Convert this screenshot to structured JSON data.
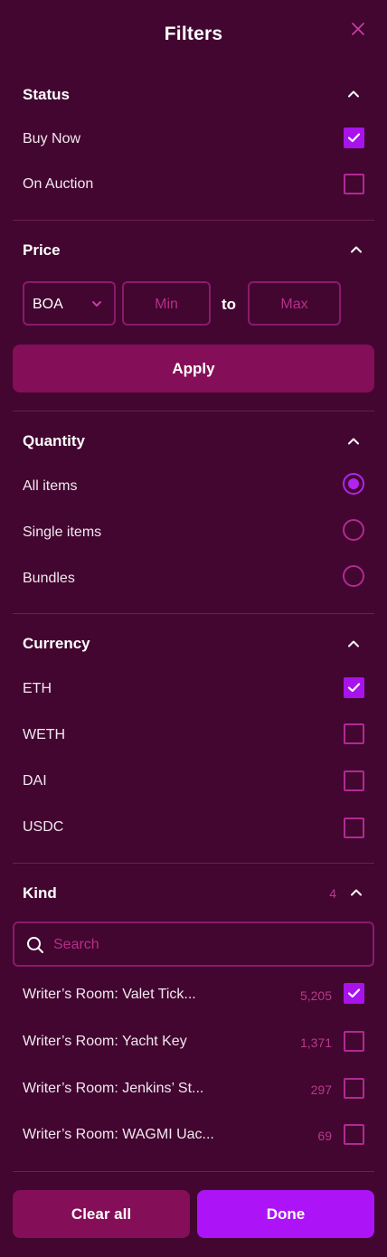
{
  "header": {
    "title": "Filters",
    "close_icon": "close-icon"
  },
  "status": {
    "title": "Status",
    "items": [
      {
        "label": "Buy Now",
        "checked": true
      },
      {
        "label": "On Auction",
        "checked": false
      }
    ]
  },
  "price": {
    "title": "Price",
    "currency_selected": "BOA",
    "min_placeholder": "Min",
    "to_label": "to",
    "max_placeholder": "Max",
    "apply_label": "Apply"
  },
  "quantity": {
    "title": "Quantity",
    "options": [
      {
        "label": "All items",
        "selected": true
      },
      {
        "label": "Single items",
        "selected": false
      },
      {
        "label": "Bundles",
        "selected": false
      }
    ]
  },
  "currency": {
    "title": "Currency",
    "items": [
      {
        "label": "ETH",
        "checked": true
      },
      {
        "label": "WETH",
        "checked": false
      },
      {
        "label": "DAI",
        "checked": false
      },
      {
        "label": "USDC",
        "checked": false
      }
    ]
  },
  "kind": {
    "title": "Kind",
    "count": "4",
    "search_placeholder": "Search",
    "items": [
      {
        "label": "Writer’s Room: Valet Tick...",
        "count": "5,205",
        "checked": true
      },
      {
        "label": "Writer’s Room: Yacht Key",
        "count": "1,371",
        "checked": false
      },
      {
        "label": "Writer’s Room: Jenkins’ St...",
        "count": "297",
        "checked": false
      },
      {
        "label": "Writer’s Room: WAGMI Uac...",
        "count": "69",
        "checked": false
      }
    ]
  },
  "footer": {
    "clear_label": "Clear all",
    "done_label": "Done"
  },
  "colors": {
    "background": "#420630",
    "accent": "#a813ec",
    "apply_button": "#850e58",
    "border": "#b12a93"
  }
}
